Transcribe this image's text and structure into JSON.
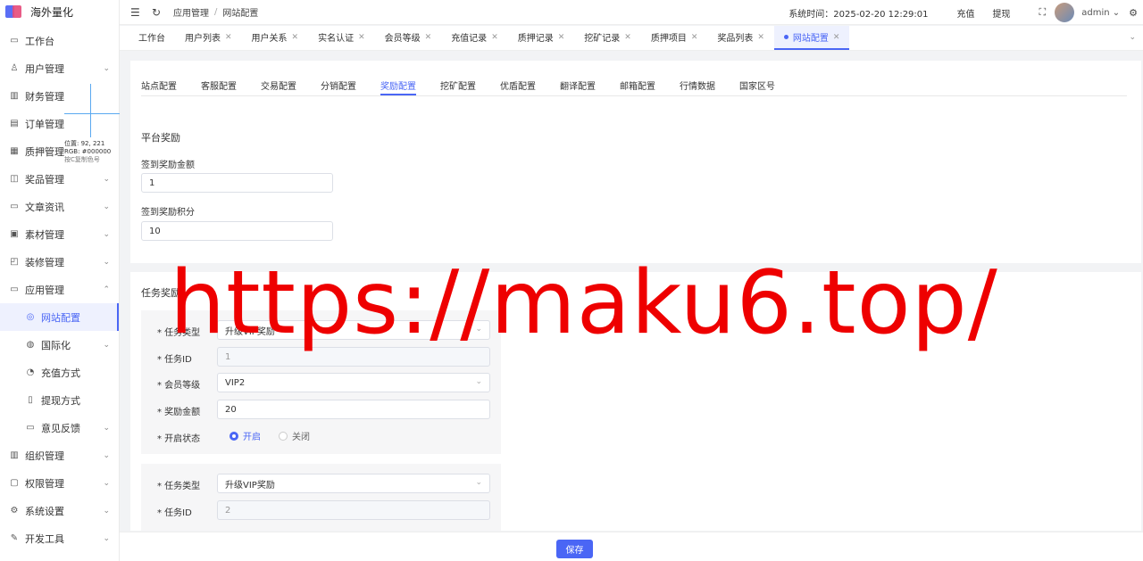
{
  "brand": {
    "name": "海外量化"
  },
  "sidebar": {
    "items": [
      {
        "label": "工作台",
        "icon": "monitor-icon",
        "glyph": "▭",
        "chevron": ""
      },
      {
        "label": "用户管理",
        "icon": "user-icon",
        "glyph": "♙",
        "chevron": "⌄"
      },
      {
        "label": "财务管理",
        "icon": "chart-icon",
        "glyph": "▥",
        "chevron": ""
      },
      {
        "label": "订单管理",
        "icon": "order-icon",
        "glyph": "▤",
        "chevron": ""
      },
      {
        "label": "质押管理",
        "icon": "pledge-icon",
        "glyph": "▦",
        "chevron": ""
      },
      {
        "label": "奖品管理",
        "icon": "gift-icon",
        "glyph": "◫",
        "chevron": "⌄"
      },
      {
        "label": "文章资讯",
        "icon": "article-icon",
        "glyph": "▭",
        "chevron": "⌄"
      },
      {
        "label": "素材管理",
        "icon": "image-icon",
        "glyph": "▣",
        "chevron": "⌄"
      },
      {
        "label": "装修管理",
        "icon": "decorate-icon",
        "glyph": "◰",
        "chevron": "⌄"
      },
      {
        "label": "应用管理",
        "icon": "app-icon",
        "glyph": "▭",
        "chevron": "⌃"
      },
      {
        "label": "网站配置",
        "icon": "globe-icon",
        "glyph": "◎",
        "chevron": "",
        "sub": true,
        "active": true
      },
      {
        "label": "国际化",
        "icon": "international-icon",
        "glyph": "◍",
        "chevron": "⌄",
        "sub": true
      },
      {
        "label": "充值方式",
        "icon": "recharge-icon",
        "glyph": "◔",
        "chevron": "",
        "sub": true
      },
      {
        "label": "提现方式",
        "icon": "withdraw-icon",
        "glyph": "▯",
        "chevron": "",
        "sub": true
      },
      {
        "label": "意见反馈",
        "icon": "feedback-icon",
        "glyph": "▭",
        "chevron": "⌄",
        "sub": true
      },
      {
        "label": "组织管理",
        "icon": "org-icon",
        "glyph": "▥",
        "chevron": "⌄"
      },
      {
        "label": "权限管理",
        "icon": "lock-icon",
        "glyph": "▢",
        "chevron": "⌄"
      },
      {
        "label": "系统设置",
        "icon": "gear-icon",
        "glyph": "⚙",
        "chevron": "⌄"
      },
      {
        "label": "开发工具",
        "icon": "tool-icon",
        "glyph": "✎",
        "chevron": "⌄"
      }
    ]
  },
  "header": {
    "menu_glyph": "☰",
    "refresh_glyph": "↻",
    "breadcrumb": [
      "应用管理",
      "网站配置"
    ],
    "breadcrumb_sep": "/",
    "system_time": "系统时间：2025-02-20 12:29:01",
    "recharge": "充值",
    "withdraw": "提现",
    "fullscreen_glyph": "⛶",
    "username": "admin ⌄",
    "settings_glyph": "⚙"
  },
  "tabs": [
    {
      "label": "工作台",
      "close": ""
    },
    {
      "label": "用户列表",
      "close": "✕"
    },
    {
      "label": "用户关系",
      "close": "✕"
    },
    {
      "label": "实名认证",
      "close": "✕"
    },
    {
      "label": "会员等级",
      "close": "✕"
    },
    {
      "label": "充值记录",
      "close": "✕"
    },
    {
      "label": "质押记录",
      "close": "✕"
    },
    {
      "label": "挖矿记录",
      "close": "✕"
    },
    {
      "label": "质押项目",
      "close": "✕"
    },
    {
      "label": "奖品列表",
      "close": "✕"
    },
    {
      "label": "网站配置",
      "close": "✕",
      "active": true
    }
  ],
  "tabs_more_glyph": "⌄",
  "config_tabs": [
    "站点配置",
    "客服配置",
    "交易配置",
    "分销配置",
    "奖励配置",
    "挖矿配置",
    "优盾配置",
    "翻译配置",
    "邮箱配置",
    "行情数据",
    "国家区号"
  ],
  "config_active_index": 4,
  "platform_reward": {
    "title": "平台奖励",
    "signin_amount_label": "签到奖励金额",
    "signin_amount_value": "1",
    "signin_points_label": "签到奖励积分",
    "signin_points_value": "10"
  },
  "task_reward": {
    "title": "任务奖励",
    "select_arrow": "⌄",
    "task1": {
      "type_label": "* 任务类型",
      "type_value": "升级VIP奖励",
      "id_label": "* 任务ID",
      "id_value": "1",
      "level_label": "* 会员等级",
      "level_value": "VIP2",
      "amount_label": "* 奖励金额",
      "amount_value": "20",
      "status_label": "* 开启状态",
      "status_on": "开启",
      "status_off": "关闭"
    },
    "task2": {
      "type_label": "* 任务类型",
      "type_value": "升级VIP奖励",
      "id_label": "* 任务ID",
      "id_value": "2"
    }
  },
  "footer": {
    "save_label": "保存"
  },
  "picker": {
    "position": "位置: 92, 221",
    "rgb": "RGB: #000000",
    "hint": "按C复制色号"
  },
  "watermark": "https://maku6.top/",
  "colors": {
    "accent": "#4a66f5",
    "watermark": "#ee0000"
  }
}
